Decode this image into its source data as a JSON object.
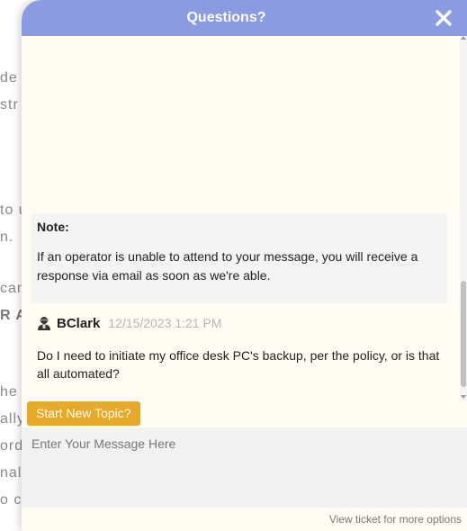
{
  "background_page": {
    "lines": [
      "de",
      "str",
      "to u",
      "n.",
      "can",
      "R A",
      "he r",
      "ally",
      "ord",
      "nal",
      "o c"
    ]
  },
  "header": {
    "title": "Questions?",
    "close_icon": "close-x-icon",
    "color": "#8a9be2"
  },
  "note": {
    "title": "Note:",
    "text": "If an operator is unable to attend to your message, you will receive a response via email as soon as we're able."
  },
  "message": {
    "user_icon": "user-agent-icon",
    "user": "BClark",
    "timestamp": "12/15/2023 1:21 PM",
    "text": "Do I need to initiate my office desk PC's backup, per the policy, or is that all automated?"
  },
  "actions": {
    "start_new_topic_label": "Start New Topic?",
    "accent_color": "#e6a92b"
  },
  "composer": {
    "placeholder": "Enter Your Message Here"
  },
  "footer": {
    "link_label": "View ticket for more options"
  }
}
